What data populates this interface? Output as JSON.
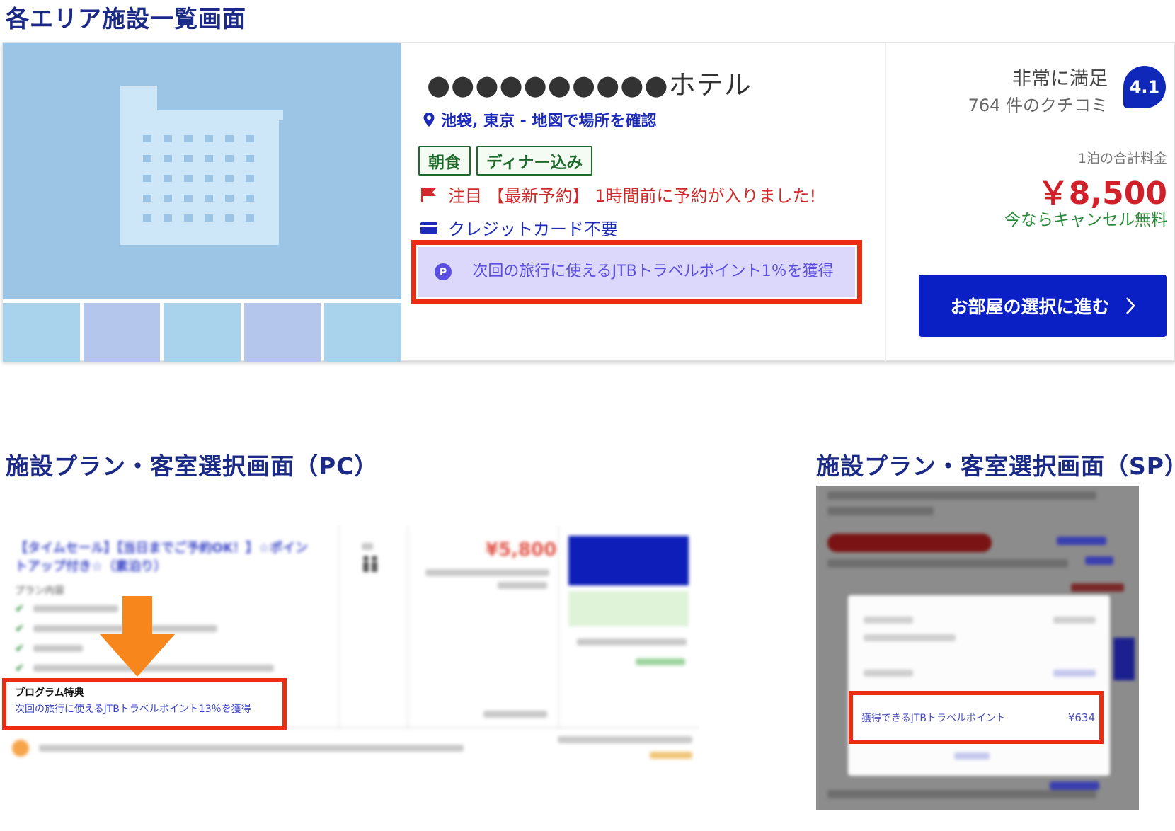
{
  "sections": {
    "list_title": "各エリア施設一覧画面",
    "pc_title": "施設プラン・客室選択画面（PC）",
    "sp_title": "施設プラン・客室選択画面（SP）"
  },
  "listing": {
    "hotel_name": "●●●●●●●●●●ホテル",
    "location": "池袋, 東京 - 地図で場所を確認",
    "tags": [
      "朝食",
      "ディナー込み"
    ],
    "notice": "注目 【最新予約】 1時間前に予約が入りました!",
    "credit": "クレジットカード不要",
    "points": "次回の旅行に使えるJTBトラベルポイント1％を獲得",
    "rating_label": "非常に満足",
    "review_count": "764 件のクチコミ",
    "rating_score": "4.1",
    "price_label": "1泊の合計料金",
    "price": "￥8,500",
    "cancel": "今ならキャンセル無料",
    "cta": "お部屋の選択に進む"
  },
  "pc": {
    "program_label": "プログラム特典",
    "program_text": "次回の旅行に使えるJTBトラベルポイント13％を獲得"
  },
  "sp": {
    "highlight_label": "獲得できるJTBトラベルポイント",
    "highlight_value": "¥634"
  },
  "colors": {
    "accent_blue": "#0a20c4",
    "highlight_red": "#ec2d12",
    "price_red": "#d2202a",
    "cancel_green": "#2a8a3a",
    "arrow_orange": "#f7871c"
  }
}
